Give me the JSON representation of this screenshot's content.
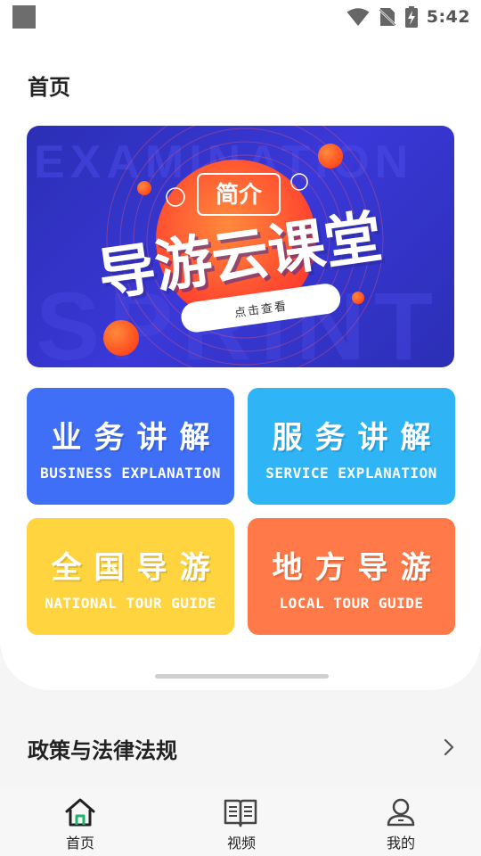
{
  "status_bar": {
    "time": "5:42"
  },
  "header": {
    "title": "首页"
  },
  "banner": {
    "tag": "简介",
    "headline": "导游云课堂",
    "cta": "点击查看",
    "watermark_top": "EXAMINATION",
    "watermark_bottom": "SPRINT"
  },
  "tiles": [
    {
      "cn": "业务讲解",
      "en": "BUSINESS EXPLANATION",
      "color": "#3e6ff6"
    },
    {
      "cn": "服务讲解",
      "en": "SERVICE EXPLANATION",
      "color": "#2fb4f5"
    },
    {
      "cn": "全国导游",
      "en": "NATIONAL TOUR GUIDE",
      "color": "#ffd43e"
    },
    {
      "cn": "地方导游",
      "en": "LOCAL TOUR GUIDE",
      "color": "#ff7a48"
    }
  ],
  "section": {
    "title": "政策与法律法规"
  },
  "bottom_nav": {
    "items": [
      {
        "label": "首页",
        "icon": "home-icon",
        "active": true
      },
      {
        "label": "视频",
        "icon": "book-icon"
      },
      {
        "label": "我的",
        "icon": "user-icon"
      }
    ]
  },
  "colors": {
    "accent_green": "#1fb36b",
    "banner_blue": "#3a38d8",
    "banner_orange": "#ff6a2c"
  }
}
